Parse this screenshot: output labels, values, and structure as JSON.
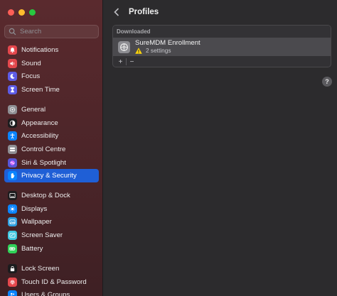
{
  "window": {
    "traffic_lights": [
      "close",
      "minimize",
      "zoom"
    ]
  },
  "sidebar": {
    "search_placeholder": "Search",
    "groups": [
      {
        "items": [
          {
            "label": "Notifications",
            "icon": "bell-icon",
            "color": "#e5484d"
          },
          {
            "label": "Sound",
            "icon": "speaker-icon",
            "color": "#e5484d"
          },
          {
            "label": "Focus",
            "icon": "moon-icon",
            "color": "#5e5ce6"
          },
          {
            "label": "Screen Time",
            "icon": "hourglass-icon",
            "color": "#5e5ce6"
          }
        ]
      },
      {
        "items": [
          {
            "label": "General",
            "icon": "gear-icon",
            "color": "#8e8e93"
          },
          {
            "label": "Appearance",
            "icon": "appearance-icon",
            "color": "#1c1c1e"
          },
          {
            "label": "Accessibility",
            "icon": "accessibility-icon",
            "color": "#0a84ff"
          },
          {
            "label": "Control Centre",
            "icon": "control-centre-icon",
            "color": "#8e8e93"
          },
          {
            "label": "Siri & Spotlight",
            "icon": "siri-icon",
            "color": "#5856d6"
          },
          {
            "label": "Privacy & Security",
            "icon": "hand-icon",
            "color": "#0a84ff",
            "selected": true
          }
        ]
      },
      {
        "items": [
          {
            "label": "Desktop & Dock",
            "icon": "dock-icon",
            "color": "#1c1c1e"
          },
          {
            "label": "Displays",
            "icon": "sun-icon",
            "color": "#0a84ff"
          },
          {
            "label": "Wallpaper",
            "icon": "wallpaper-icon",
            "color": "#30a0e0"
          },
          {
            "label": "Screen Saver",
            "icon": "screen-saver-icon",
            "color": "#40c8e0"
          },
          {
            "label": "Battery",
            "icon": "battery-icon",
            "color": "#30d158"
          }
        ]
      },
      {
        "items": [
          {
            "label": "Lock Screen",
            "icon": "lock-icon",
            "color": "#1c1c1e"
          },
          {
            "label": "Touch ID & Password",
            "icon": "fingerprint-icon",
            "color": "#e5484d"
          },
          {
            "label": "Users & Groups",
            "icon": "users-icon",
            "color": "#0a84ff"
          }
        ]
      }
    ]
  },
  "main": {
    "title": "Profiles",
    "section_header": "Downloaded",
    "profile": {
      "name": "SureMDM Enrollment",
      "sub": "2 settings"
    },
    "add_label": "+",
    "remove_label": "−",
    "help_label": "?"
  },
  "colors": {
    "accent": "#1f5fd6",
    "warning": "#ffd60a"
  }
}
